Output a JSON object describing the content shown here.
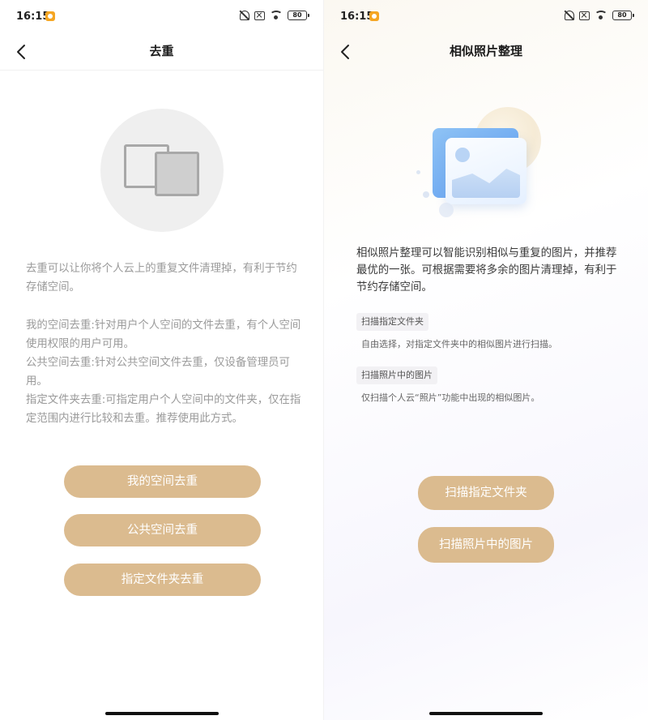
{
  "status_bar": {
    "time": "16:15",
    "battery": "80",
    "icons": [
      "app-notification-icon",
      "mute-bell-icon",
      "no-sim-icon",
      "wifi-icon",
      "battery-icon"
    ]
  },
  "left_screen": {
    "title": "去重",
    "back_icon": "chevron-left-icon",
    "illustration_icon": "duplicate-files-icon",
    "description": {
      "intro": "去重可以让你将个人云上的重复文件清理掉，有利于节约存储空间。",
      "my_space": "我的空间去重:针对用户个人空间的文件去重，有个人空间使用权限的用户可用。",
      "public_space": "公共空间去重:针对公共空间文件去重，仅设备管理员可用。",
      "folder": "指定文件夹去重:可指定用户个人空间中的文件夹，仅在指定范围内进行比较和去重。推荐使用此方式。"
    },
    "buttons": {
      "my_space": "我的空间去重",
      "public_space": "公共空间去重",
      "folder": "指定文件夹去重"
    }
  },
  "right_screen": {
    "title": "相似照片整理",
    "back_icon": "chevron-left-icon",
    "illustration_icon": "photo-gallery-icon",
    "description": "相似照片整理可以智能识别相似与重复的图片，并推荐最优的一张。可根据需要将多余的图片清理掉，有利于节约存储空间。",
    "options": [
      {
        "tag": "扫描指定文件夹",
        "note": "自由选择，对指定文件夹中的相似图片进行扫描。"
      },
      {
        "tag": "扫描照片中的图片",
        "note": "仅扫描个人云“照片”功能中出现的相似图片。"
      }
    ],
    "buttons": {
      "scan_folder": "扫描指定文件夹",
      "scan_photos": "扫描照片中的图片"
    }
  },
  "colors": {
    "button": "#dbbb8f",
    "button_text": "#ffffff",
    "muted_text": "#9a9a9a",
    "app_badge": "#f5a623"
  }
}
